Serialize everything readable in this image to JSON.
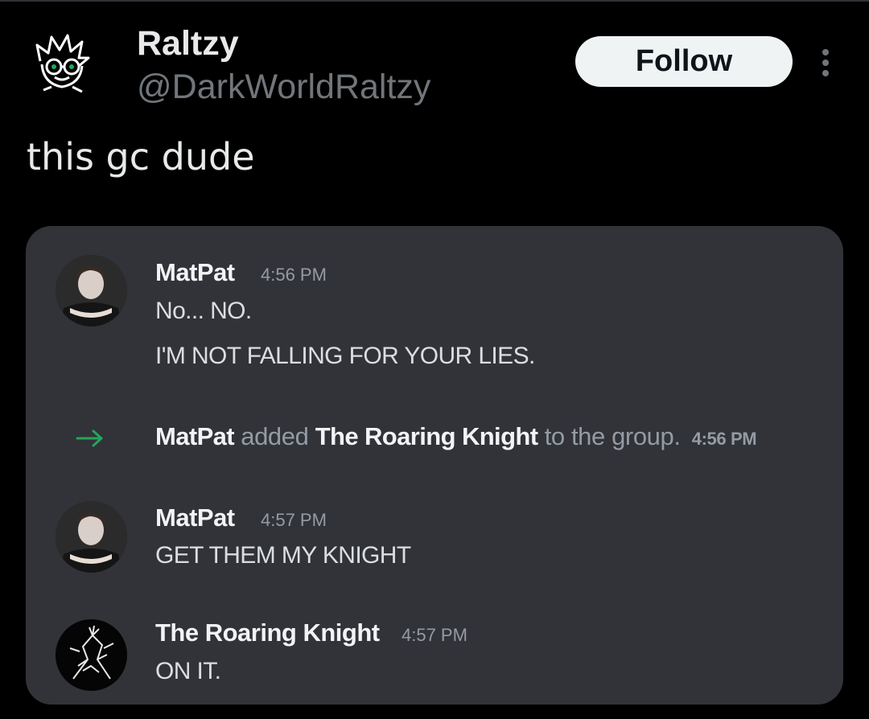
{
  "tweet": {
    "display_name": "Raltzy",
    "handle": "@DarkWorldRaltzy",
    "follow_label": "Follow",
    "text": "this gc dude",
    "more_icon": "more-vertical-icon"
  },
  "discord": {
    "messages": [
      {
        "author": "MatPat",
        "time": "4:56 PM",
        "lines": [
          "No... NO.",
          "I'M NOT FALLING FOR YOUR LIES."
        ]
      },
      {
        "author": "MatPat",
        "time": "4:57 PM",
        "lines": [
          "GET THEM MY KNIGHT"
        ]
      },
      {
        "author": "The Roaring Knight",
        "time": "4:57 PM",
        "lines": [
          "ON IT."
        ]
      }
    ],
    "system": {
      "actor": "MatPat",
      "verb": "added",
      "target": "The Roaring Knight",
      "suffix": "to the group.",
      "time": "4:56 PM",
      "icon": "join-arrow-icon",
      "icon_color": "#23a55a"
    },
    "colors": {
      "background": "#313338",
      "author": "#f2f3f5",
      "text": "#dbdee1",
      "muted": "#949ba4"
    }
  }
}
